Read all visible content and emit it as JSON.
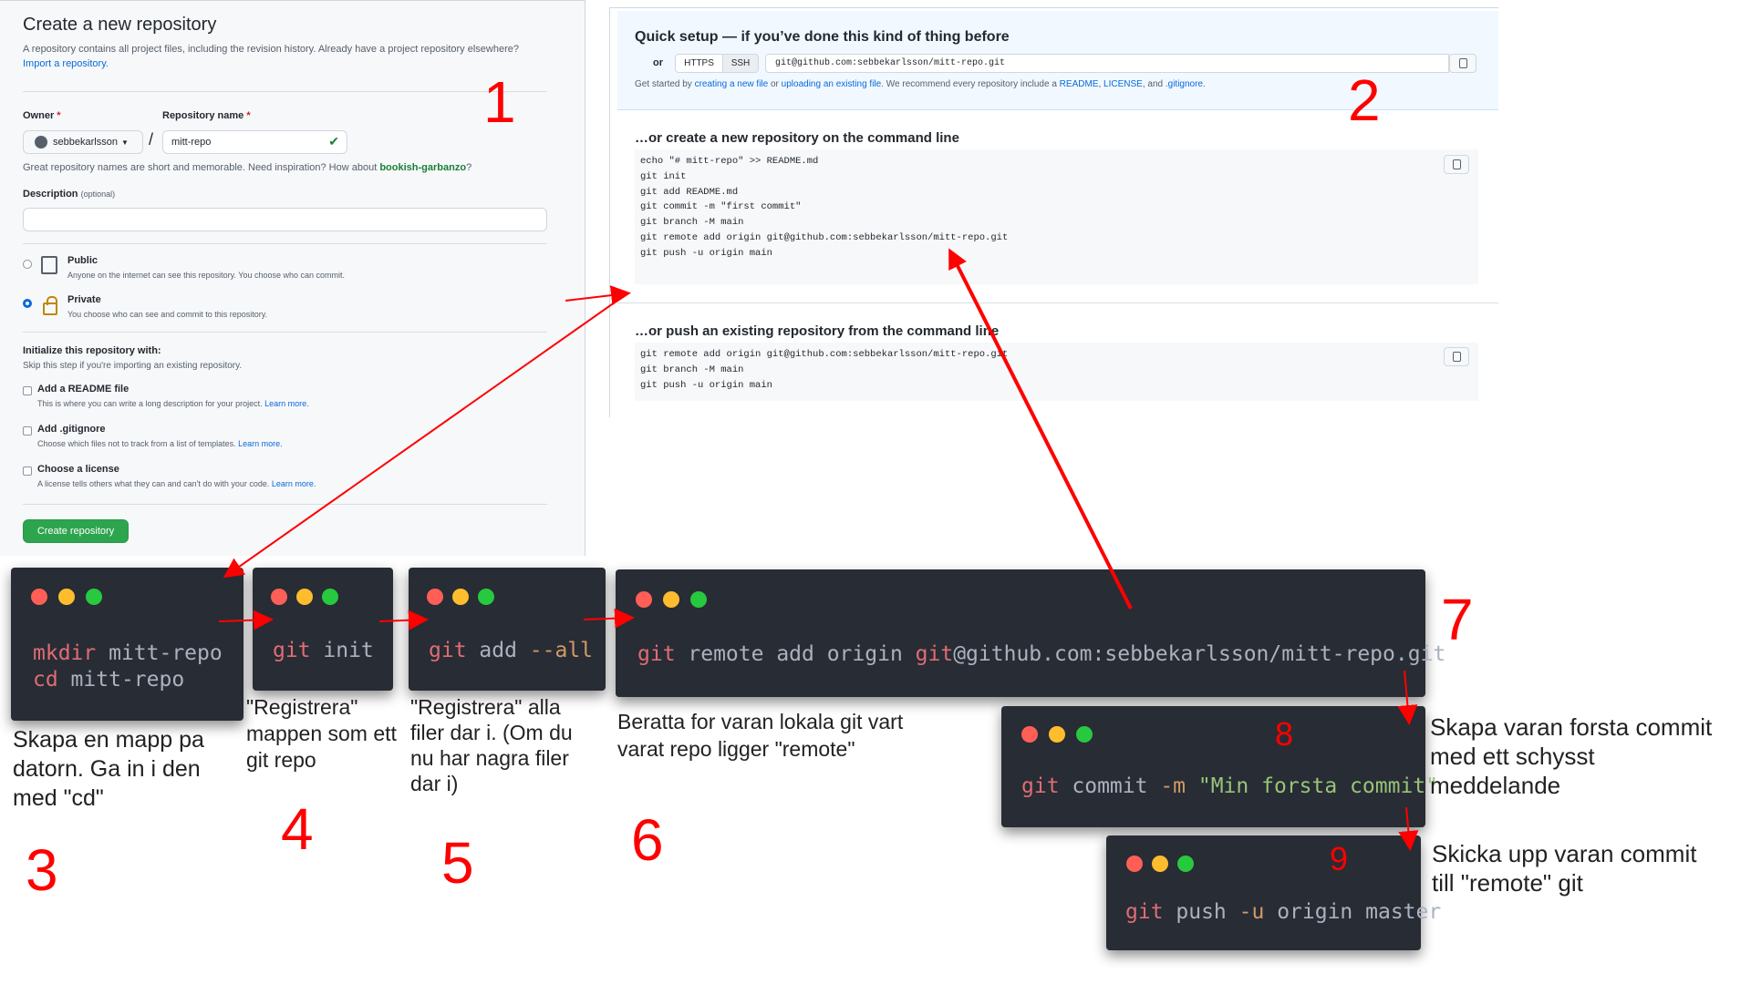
{
  "create_form": {
    "title": "Create a new repository",
    "subtitle": "A repository contains all project files, including the revision history. Already have a project repository elsewhere?",
    "import_link": "Import a repository.",
    "owner_label": "Owner",
    "required_mark": "*",
    "repo_name_label": "Repository name",
    "owner_value": "sebbekarlsson",
    "slash": "/",
    "repo_name_value": "mitt-repo",
    "name_hint": "Great repository names are short and memorable. Need inspiration? How about",
    "name_suggestion": "bookish-garbanzo",
    "name_hint_end": "?",
    "description_label": "Description",
    "optional_label": "(optional)",
    "visibility": [
      {
        "title": "Public",
        "desc": "Anyone on the internet can see this repository. You choose who can commit.",
        "selected": false
      },
      {
        "title": "Private",
        "desc": "You choose who can see and commit to this repository.",
        "selected": true
      }
    ],
    "init_title": "Initialize this repository with:",
    "init_sub": "Skip this step if you're importing an existing repository.",
    "init_options": [
      {
        "title": "Add a README file",
        "desc": "This is where you can write a long description for your project.",
        "link": "Learn more."
      },
      {
        "title": "Add .gitignore",
        "desc": "Choose which files not to track from a list of templates.",
        "link": "Learn more."
      },
      {
        "title": "Choose a license",
        "desc": "A license tells others what they can and can't do with your code.",
        "link": "Learn more."
      }
    ],
    "create_button": "Create repository"
  },
  "quick_setup": {
    "title": "Quick setup — if you’ve done this kind of thing before",
    "or_label": "or",
    "https_label": "HTTPS",
    "ssh_label": "SSH",
    "url": "git@github.com:sebbekarlsson/mitt-repo.git",
    "hint_start": "Get started by",
    "hint_link1": "creating a new file",
    "hint_or": "or",
    "hint_link2": "uploading an existing file",
    "hint_mid": ". We recommend every repository include a",
    "hint_readme": "README",
    "hint_comma": ",",
    "hint_license": "LICENSE",
    "hint_and": ", and",
    "hint_gitignore": ".gitignore",
    "hint_end": "."
  },
  "cmd_new": {
    "title": "…or create a new repository on the command line",
    "lines": [
      "echo \"# mitt-repo\" >> README.md",
      "git init",
      "git add README.md",
      "git commit -m \"first commit\"",
      "git branch -M main",
      "git remote add origin git@github.com:sebbekarlsson/mitt-repo.git",
      "git push -u origin main"
    ]
  },
  "cmd_push": {
    "title": "…or push an existing repository from the command line",
    "lines": [
      "git remote add origin git@github.com:sebbekarlsson/mitt-repo.git",
      "git branch -M main",
      "git push -u origin main"
    ]
  },
  "terminals": {
    "t3": {
      "l1_kw": "mkdir",
      "l1_rest": " mitt-repo",
      "l2_kw": "cd",
      "l2_rest": " mitt-repo"
    },
    "t4": {
      "kw": "git",
      "rest": " init"
    },
    "t5": {
      "kw": "git",
      "rest": " add ",
      "flag": "--all"
    },
    "t7": {
      "kw": "git",
      "rest": " remote add origin ",
      "kw2": "git",
      "rest2": "@github.com:sebbekarlsson/mitt-repo.git"
    },
    "t8": {
      "kw": "git",
      "rest": " commit ",
      "flag": "-m",
      "space": " ",
      "str": "\"Min forsta commit\""
    },
    "t9": {
      "kw": "git",
      "rest": " push ",
      "flag": "-u",
      "rest2": " origin master"
    }
  },
  "steps": {
    "n1": "1",
    "n2": "2",
    "n3": "3",
    "n4": "4",
    "n5": "5",
    "n6": "6",
    "n7": "7",
    "n8": "8",
    "n9": "9"
  },
  "captions": {
    "c3": [
      "Skapa en mapp pa",
      "datorn. Ga in i den",
      "med \"cd\""
    ],
    "c4": [
      "\"Registrera\"",
      "mappen som ett",
      "git repo"
    ],
    "c5": [
      "\"Registrera\" alla",
      "filer dar i. (Om du",
      "nu har nagra filer",
      "dar i)"
    ],
    "c6": [
      "Beratta for varan lokala git vart",
      "varat repo ligger \"remote\""
    ],
    "c8": [
      "Skapa varan forsta commit",
      "med ett schysst",
      "meddelande"
    ],
    "c9": [
      "Skicka upp varan commit",
      "till \"remote\" git"
    ]
  },
  "colors": {
    "annotation_red": "#ff0000",
    "terminal_bg": "#282c34",
    "keyword": "#e06c75",
    "flag": "#d19a66",
    "string": "#98c379",
    "create_button": "#2da44e",
    "link": "#0969da"
  },
  "icons": [
    "check-icon",
    "repo-icon",
    "lock-icon",
    "clipboard-icon",
    "caret-down-icon"
  ]
}
